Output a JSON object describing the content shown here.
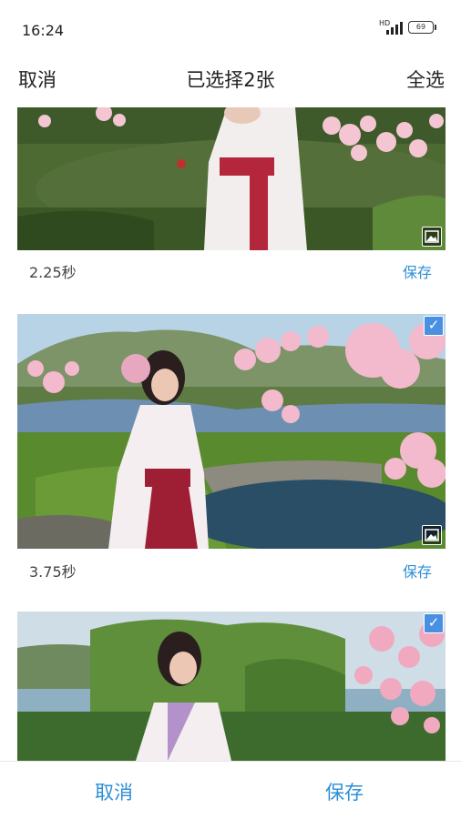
{
  "status": {
    "time": "16:24",
    "network": "HD",
    "battery": "69"
  },
  "header": {
    "cancel": "取消",
    "title": "已选择2张",
    "select_all": "全选"
  },
  "items": [
    {
      "duration": "2.25秒",
      "save": "保存",
      "selected": false
    },
    {
      "duration": "3.75秒",
      "save": "保存",
      "selected": true
    },
    {
      "duration": "",
      "save": "",
      "selected": true
    }
  ],
  "footer": {
    "cancel": "取消",
    "save": "保存"
  },
  "icons": {
    "check": "check-icon",
    "image_badge": "image-icon",
    "signal": "signal-icon",
    "battery": "battery-icon"
  },
  "colors": {
    "accent": "#2d8fd5",
    "checkbox": "#4a90e2"
  }
}
